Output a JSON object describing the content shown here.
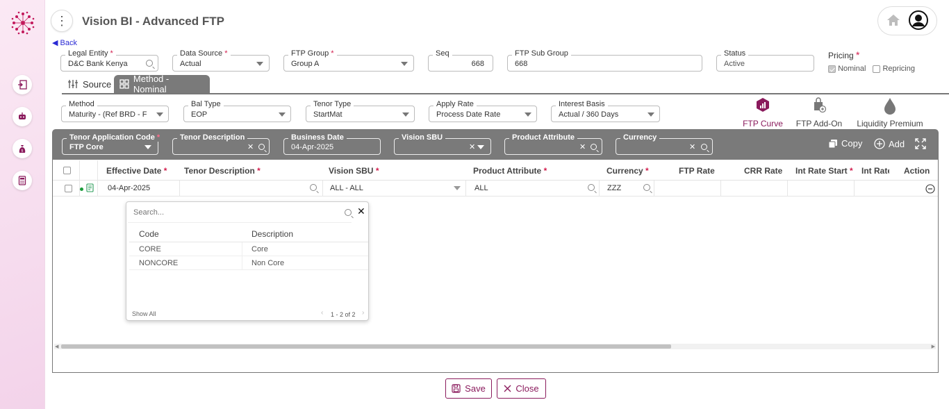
{
  "app": {
    "title": "Vision BI - Advanced FTP",
    "back_label": "Back"
  },
  "header_fields": {
    "legal_entity": {
      "label": "Legal Entity",
      "value": "D&C Bank Kenya"
    },
    "data_source": {
      "label": "Data Source",
      "value": "Actual"
    },
    "ftp_group": {
      "label": "FTP Group",
      "value": "Group A"
    },
    "seq": {
      "label": "Seq",
      "value": "668"
    },
    "ftp_sub_group": {
      "label": "FTP Sub Group",
      "value": "668"
    },
    "status": {
      "label": "Status",
      "value": "Active"
    },
    "pricing": {
      "label": "Pricing",
      "nominal": "Nominal",
      "repricing": "Repricing"
    }
  },
  "tabs": {
    "source": "Source",
    "method": "Method - Nominal"
  },
  "method_fields": {
    "method": {
      "label": "Method",
      "value": "Maturity - (Ref BRD - F"
    },
    "bal_type": {
      "label": "Bal Type",
      "value": "EOP"
    },
    "tenor_type": {
      "label": "Tenor Type",
      "value": "StartMat"
    },
    "apply_rate": {
      "label": "Apply Rate",
      "value": "Process Date Rate"
    },
    "interest_basis": {
      "label": "Interest Basis",
      "value": "Actual / 360 Days"
    }
  },
  "curve_actions": {
    "ftp_curve": "FTP Curve",
    "ftp_addon": "FTP Add-On",
    "liquidity": "Liquidity Premium"
  },
  "filters": {
    "tenor_app_code": {
      "label": "Tenor Application Code",
      "value": "FTP Core"
    },
    "tenor_desc": {
      "label": "Tenor Description",
      "value": ""
    },
    "business_date": {
      "label": "Business Date",
      "value": "04-Apr-2025"
    },
    "vision_sbu": {
      "label": "Vision SBU",
      "value": ""
    },
    "product_attribute": {
      "label": "Product Attribute",
      "value": ""
    },
    "currency": {
      "label": "Currency",
      "value": ""
    },
    "copy_label": "Copy",
    "add_label": "Add"
  },
  "table": {
    "headers": {
      "effective_date": "Effective Date",
      "tenor_description": "Tenor Description",
      "vision_sbu": "Vision SBU",
      "product_attribute": "Product Attribute",
      "currency": "Currency",
      "ftp_rate": "FTP Rate",
      "crr_rate": "CRR Rate",
      "int_rate_start": "Int Rate Start",
      "int_rate_end": "Int Rate E",
      "action": "Action"
    },
    "row": {
      "effective_date": "04-Apr-2025",
      "tenor_description": "",
      "vision_sbu": "ALL - ALL",
      "product_attribute": "ALL",
      "currency": "ZZZ"
    }
  },
  "dropdown": {
    "search_placeholder": "Search...",
    "col_code": "Code",
    "col_desc": "Description",
    "rows": [
      {
        "code": "CORE",
        "desc": "Core"
      },
      {
        "code": "NONCORE",
        "desc": "Non Core"
      }
    ],
    "show_all": "Show All",
    "pagination": "1 - 2 of 2"
  },
  "footer": {
    "save": "Save",
    "close": "Close"
  },
  "colors": {
    "accent": "#8a1a5c",
    "toolbar": "#7a7a7a",
    "brand": "#c2185b"
  }
}
